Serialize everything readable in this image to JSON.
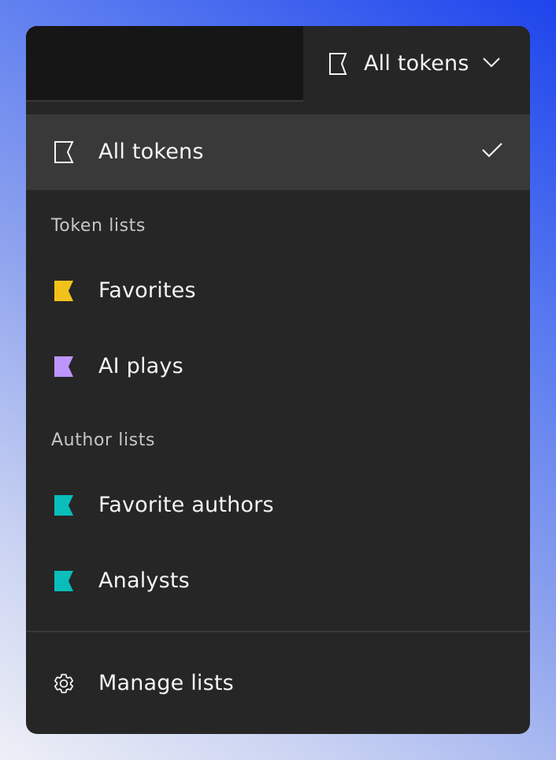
{
  "dropdown": {
    "selected_label": "All tokens",
    "trigger_icon": "flag-outline-icon",
    "chevron_icon": "chevron-down-icon"
  },
  "menu": {
    "all_tokens": {
      "label": "All tokens",
      "icon": "flag-outline-icon",
      "selected": true,
      "check_icon": "checkmark-icon"
    },
    "sections": [
      {
        "title": "Token lists",
        "items": [
          {
            "label": "Favorites",
            "icon": "flag-icon",
            "color": "#f1c21b"
          },
          {
            "label": "AI plays",
            "icon": "flag-icon",
            "color": "#be95ff"
          }
        ]
      },
      {
        "title": "Author lists",
        "items": [
          {
            "label": "Favorite authors",
            "icon": "flag-icon",
            "color": "#08bdba"
          },
          {
            "label": "Analysts",
            "icon": "flag-icon",
            "color": "#08bdba"
          }
        ]
      }
    ],
    "footer": {
      "label": "Manage lists",
      "icon": "gear-icon"
    }
  },
  "colors": {
    "panel_bg": "#262626",
    "selected_bg": "#393939",
    "text_primary": "#f4f4f4",
    "text_secondary": "#c6c6c6"
  }
}
